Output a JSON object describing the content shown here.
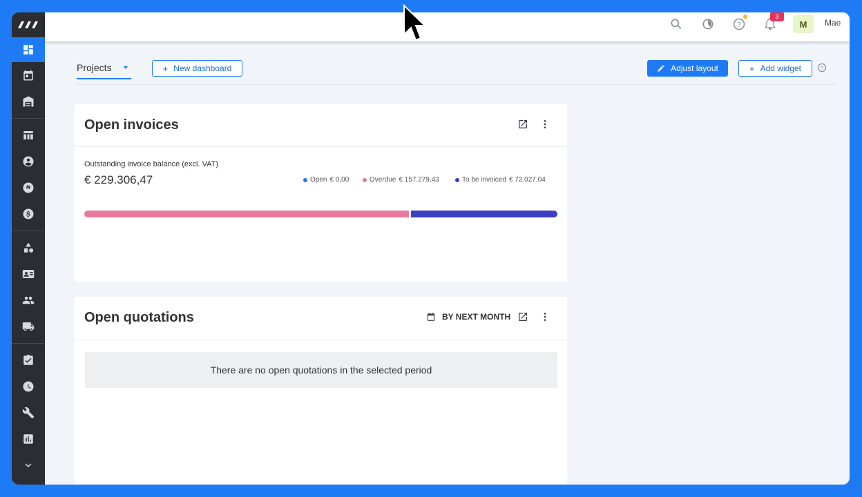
{
  "header": {
    "notification_count": "3",
    "user_initial": "M",
    "user_name": "Mae"
  },
  "toolbar": {
    "projects_label": "Projects",
    "new_dashboard_label": "New dashboard",
    "adjust_layout_label": "Adjust layout",
    "add_widget_label": "Add widget"
  },
  "invoices_card": {
    "title": "Open invoices",
    "subtitle": "Outstanding invoice balance (excl. VAT)",
    "total": "€ 229.306,47",
    "legend": [
      {
        "label": "Open",
        "value": "€ 0,00",
        "color": "#2a7be4"
      },
      {
        "label": "Overdue",
        "value": "€ 157.279,43",
        "color": "#e87aa0"
      },
      {
        "label": "To be invoiced",
        "value": "€ 72.027,04",
        "color": "#3b3fc4"
      }
    ],
    "bar_fractions": {
      "open": 0.0,
      "overdue": 0.686,
      "to_be_invoiced": 0.314
    }
  },
  "quotations_card": {
    "title": "Open quotations",
    "period_label": "BY NEXT MONTH",
    "empty_message": "There are no open quotations in the selected period"
  },
  "colors": {
    "accent": "#1e7bf5",
    "sidebar": "#2a2d31",
    "badge": "#e5335a"
  }
}
